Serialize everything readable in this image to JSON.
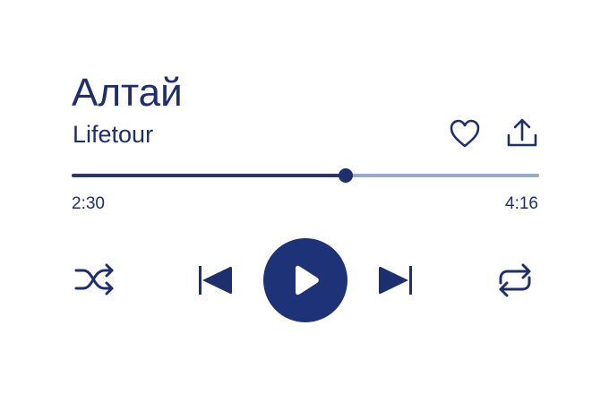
{
  "track": {
    "title": "Алтай",
    "artist": "Lifetour"
  },
  "playback": {
    "elapsed": "2:30",
    "total": "4:16",
    "progress_fraction": 0.5859
  },
  "icons": {
    "favorite": "heart-icon",
    "share": "share-icon",
    "shuffle": "shuffle-icon",
    "previous": "skip-previous-icon",
    "play": "play-icon",
    "next": "skip-next-icon",
    "repeat": "repeat-icon"
  },
  "colors": {
    "accent": "#1e3278",
    "text": "#1e2f6e",
    "track_played": "#2d3560",
    "track_remaining": "#9ba9c8",
    "background": "#ffffff"
  }
}
